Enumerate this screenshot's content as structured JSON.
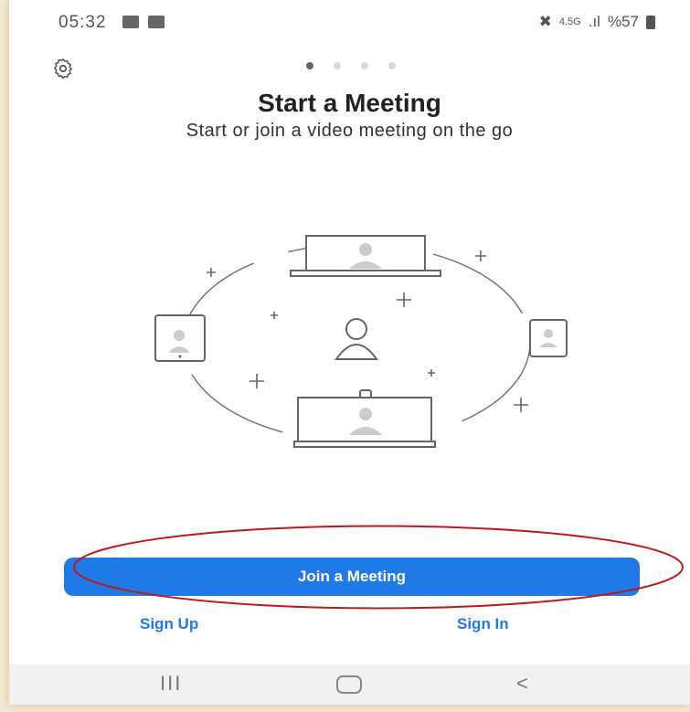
{
  "status_bar": {
    "time": "05:32",
    "network": "4.5G",
    "battery_text": "%57"
  },
  "page": {
    "title": "Start a Meeting",
    "subtitle": "Start or join a video meeting on the go",
    "page_indicator_count": 4,
    "page_indicator_active": 1
  },
  "actions": {
    "join_label": "Join a Meeting",
    "sign_up_label": "Sign Up",
    "sign_in_label": "Sign In"
  },
  "nav": {
    "recent_label": "III",
    "back_label": "<"
  },
  "colors": {
    "accent": "#1f7ae8",
    "highlight": "#c0171b"
  },
  "icons": [
    "settings-icon",
    "gallery-icon",
    "wifi-icon",
    "battery-icon",
    "laptop-icon",
    "tablet-icon",
    "phone-icon",
    "person-icon",
    "room-display-icon"
  ]
}
